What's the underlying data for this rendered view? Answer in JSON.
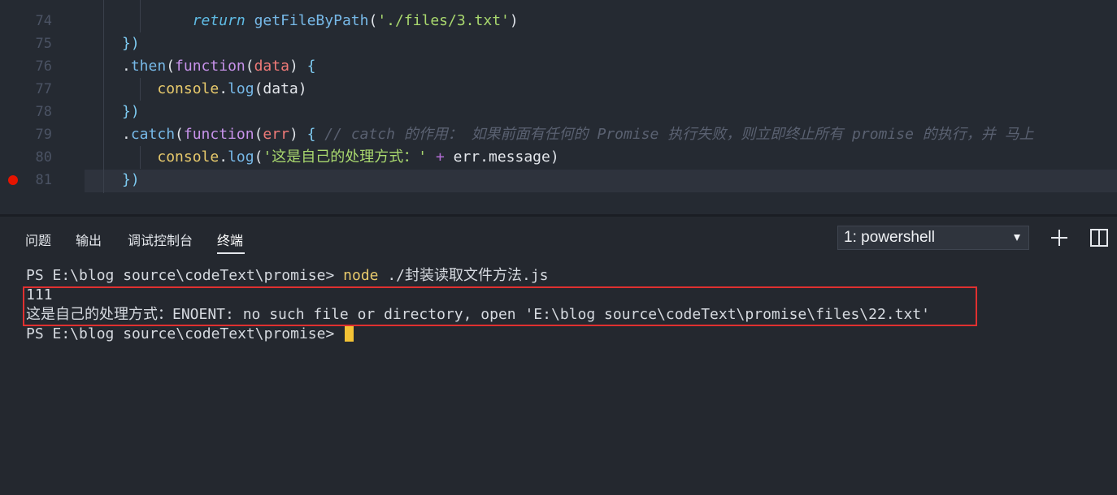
{
  "editor": {
    "lines": [
      {
        "num": "74",
        "parts": [
          {
            "t": "        ",
            "c": "plain"
          },
          {
            "t": "return",
            "c": "kw"
          },
          {
            "t": " ",
            "c": "plain"
          },
          {
            "t": "getFileByPath",
            "c": "fn"
          },
          {
            "t": "(",
            "c": "punc"
          },
          {
            "t": "'./files/3.txt'",
            "c": "str"
          },
          {
            "t": ")",
            "c": "punc"
          }
        ]
      },
      {
        "num": "75",
        "parts": [
          {
            "t": "})",
            "c": "brace"
          }
        ]
      },
      {
        "num": "76",
        "parts": [
          {
            "t": ".",
            "c": "punc"
          },
          {
            "t": "then",
            "c": "fn"
          },
          {
            "t": "(",
            "c": "punc"
          },
          {
            "t": "function",
            "c": "funk"
          },
          {
            "t": "(",
            "c": "punc"
          },
          {
            "t": "data",
            "c": "param"
          },
          {
            "t": ") ",
            "c": "punc"
          },
          {
            "t": "{",
            "c": "brace"
          }
        ]
      },
      {
        "num": "77",
        "parts": [
          {
            "t": "    ",
            "c": "plain"
          },
          {
            "t": "console",
            "c": "fnc"
          },
          {
            "t": ".",
            "c": "punc"
          },
          {
            "t": "log",
            "c": "fn"
          },
          {
            "t": "(data)",
            "c": "plain"
          }
        ]
      },
      {
        "num": "78",
        "parts": [
          {
            "t": "})",
            "c": "brace"
          }
        ]
      },
      {
        "num": "79",
        "parts": [
          {
            "t": ".",
            "c": "punc"
          },
          {
            "t": "catch",
            "c": "fn"
          },
          {
            "t": "(",
            "c": "punc"
          },
          {
            "t": "function",
            "c": "funk"
          },
          {
            "t": "(",
            "c": "punc"
          },
          {
            "t": "err",
            "c": "param"
          },
          {
            "t": ") ",
            "c": "punc"
          },
          {
            "t": "{",
            "c": "brace"
          },
          {
            "t": " // catch 的作用： 如果前面有任何的 Promise 执行失败，则立即终止所有 promise 的执行，并 马上",
            "c": "cm"
          }
        ]
      },
      {
        "num": "80",
        "parts": [
          {
            "t": "    ",
            "c": "plain"
          },
          {
            "t": "console",
            "c": "fnc"
          },
          {
            "t": ".",
            "c": "punc"
          },
          {
            "t": "log",
            "c": "fn"
          },
          {
            "t": "(",
            "c": "punc"
          },
          {
            "t": "'这是自己的处理方式：'",
            "c": "str"
          },
          {
            "t": " + ",
            "c": "op"
          },
          {
            "t": "err",
            "c": "plain"
          },
          {
            "t": ".",
            "c": "punc"
          },
          {
            "t": "message",
            "c": "plain"
          },
          {
            "t": ")",
            "c": "punc"
          }
        ]
      },
      {
        "num": "81",
        "parts": [
          {
            "t": "})",
            "c": "brace"
          }
        ]
      }
    ]
  },
  "panel": {
    "tabs": [
      "问题",
      "输出",
      "调试控制台",
      "终端"
    ],
    "active_tab": "终端",
    "terminal_select": "1: powershell",
    "add_terminal_icon": "plus-icon",
    "split_terminal_icon": "split-icon"
  },
  "terminal": {
    "prompt": "PS E:\\blog source\\codeText\\promise> ",
    "command": "node",
    "command_args": " ./封装读取文件方法.js",
    "output_1": "111",
    "output_2": "这是自己的处理方式：ENOENT: no such file or directory, open 'E:\\blog source\\codeText\\promise\\files\\22.txt'",
    "prompt_2": "PS E:\\blog source\\codeText\\promise> "
  },
  "colors": {
    "accent_cursor": "#f3c235",
    "breakpoint": "#e51400",
    "highlight_box": "#e03030"
  }
}
